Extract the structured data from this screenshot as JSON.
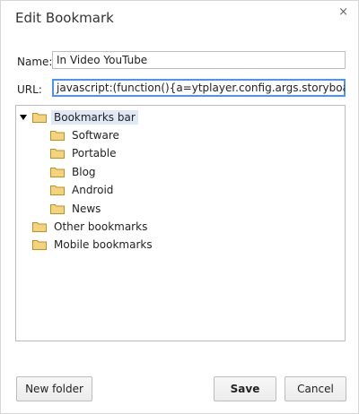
{
  "dialog": {
    "title": "Edit Bookmark",
    "close_glyph": "×"
  },
  "form": {
    "name_label": "Name:",
    "name_value": "In Video YouTube",
    "url_label": "URL:",
    "url_value": "javascript:(function(){a=ytplayer.config.args.storyboard_spec;if"
  },
  "tree": {
    "root": {
      "label": "Bookmarks bar",
      "expanded": true,
      "selected": true
    },
    "children": [
      {
        "label": "Software"
      },
      {
        "label": "Portable"
      },
      {
        "label": "Blog"
      },
      {
        "label": "Android"
      },
      {
        "label": "News"
      }
    ],
    "siblings": [
      {
        "label": "Other bookmarks"
      },
      {
        "label": "Mobile bookmarks"
      }
    ]
  },
  "buttons": {
    "new_folder": "New folder",
    "save": "Save",
    "cancel": "Cancel"
  },
  "colors": {
    "folder_fill": "#f4d37a",
    "folder_stroke": "#b8902e",
    "selection": "#e0e8f6",
    "focus_border": "#4d90fe"
  },
  "icons": {
    "close": "close-icon",
    "folder": "folder-icon",
    "expand": "triangle-down-icon"
  }
}
